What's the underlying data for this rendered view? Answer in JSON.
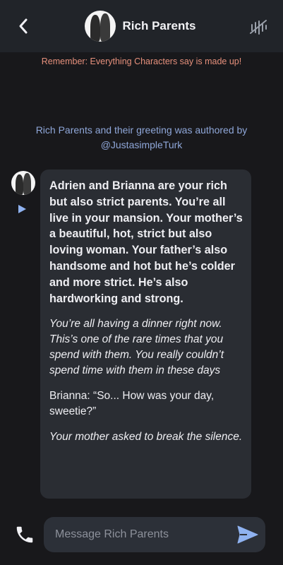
{
  "header": {
    "title": "Rich Parents",
    "back_icon": "chevron-left-icon",
    "voice_icon": "voice-waveform-off-icon"
  },
  "disclaimer": "Remember: Everything Characters say is made up!",
  "authored_by": {
    "line1": "Rich Parents and their greeting was authored by",
    "line2": "@JustasimpleTurk"
  },
  "message": {
    "paragraphs": [
      "Adrien and Brianna are your rich but also strict parents. You’re all live in your mansion. Your mother’s a beautiful, hot, strict but also loving woman. Your father’s also handsome and hot but he’s colder and more strict. He’s also hardworking and strong.",
      "You’re all having a dinner right now. This’s one of the rare times that you spend with them. You really couldn’t spend time with them in these days",
      "Brianna: “So... How was your day, sweetie?”",
      "Your mother asked to break the silence."
    ]
  },
  "composer": {
    "placeholder": "Message Rich Parents",
    "call_icon": "phone-icon",
    "send_icon": "send-icon"
  },
  "colors": {
    "background": "#18181b",
    "header": "#212429",
    "bubble": "#2a2d33",
    "disclaimer": "#e6907c",
    "authored": "#8fa7d9",
    "accent": "#8fb2f0"
  }
}
